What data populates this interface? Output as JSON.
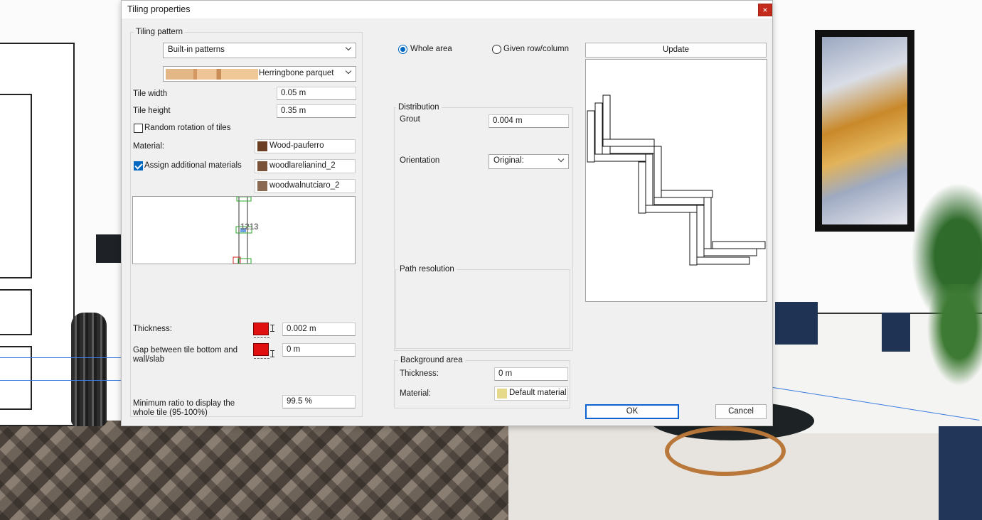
{
  "window": {
    "title": "Tiling properties",
    "close_glyph": "×"
  },
  "tiling_pattern": {
    "group_label": "Tiling pattern",
    "pattern_source": "Built-in patterns",
    "pattern_name": "Herringbone parquet",
    "tile_width_label": "Tile width",
    "tile_width_value": "0.05 m",
    "tile_height_label": "Tile height",
    "tile_height_value": "0.35 m",
    "random_rotation_label": "Random rotation of tiles",
    "random_rotation_checked": false,
    "material_label": "Material:",
    "material_value": "Wood-pauferro",
    "assign_additional_label": "Assign additional materials",
    "assign_additional_checked": true,
    "additional_materials": [
      "woodlarelianind_2",
      "woodwalnutciaro_2"
    ],
    "preview_text": "1213",
    "thickness_label": "Thickness:",
    "thickness_value": "0.002 m",
    "gap_label": "Gap between tile bottom and wall/slab",
    "gap_value": "0 m",
    "min_ratio_label": "Minimum ratio to display the whole tile (95-100%)",
    "min_ratio_value": "99.5 %"
  },
  "area": {
    "whole_area_label": "Whole area",
    "whole_area_selected": true,
    "given_rowcol_label": "Given row/column",
    "given_rowcol_selected": false
  },
  "distribution": {
    "group_label": "Distribution",
    "grout_label": "Grout",
    "grout_value": "0.004 m",
    "orientation_label": "Orientation",
    "orientation_value": "Original:"
  },
  "path_resolution": {
    "group_label": "Path resolution"
  },
  "background_area": {
    "group_label": "Background area",
    "thickness_label": "Thickness:",
    "thickness_value": "0 m",
    "material_label": "Material:",
    "material_value": "Default material"
  },
  "preview_panel": {
    "update_label": "Update"
  },
  "buttons": {
    "ok_label": "OK",
    "cancel_label": "Cancel"
  },
  "colors": {
    "accent": "#0067c0",
    "close_red": "#c42b1c",
    "thickness_swatch": "#e01010",
    "wood_pauferro": "#6b3f24",
    "woodlarelianind": "#7a5238",
    "woodwalnut": "#8a6a52",
    "default_material": "#e6d98c"
  },
  "icons": {
    "close": "close-icon",
    "dropdown": "chevron-down-icon",
    "thickness": "thickness-icon",
    "gap": "gap-icon"
  }
}
